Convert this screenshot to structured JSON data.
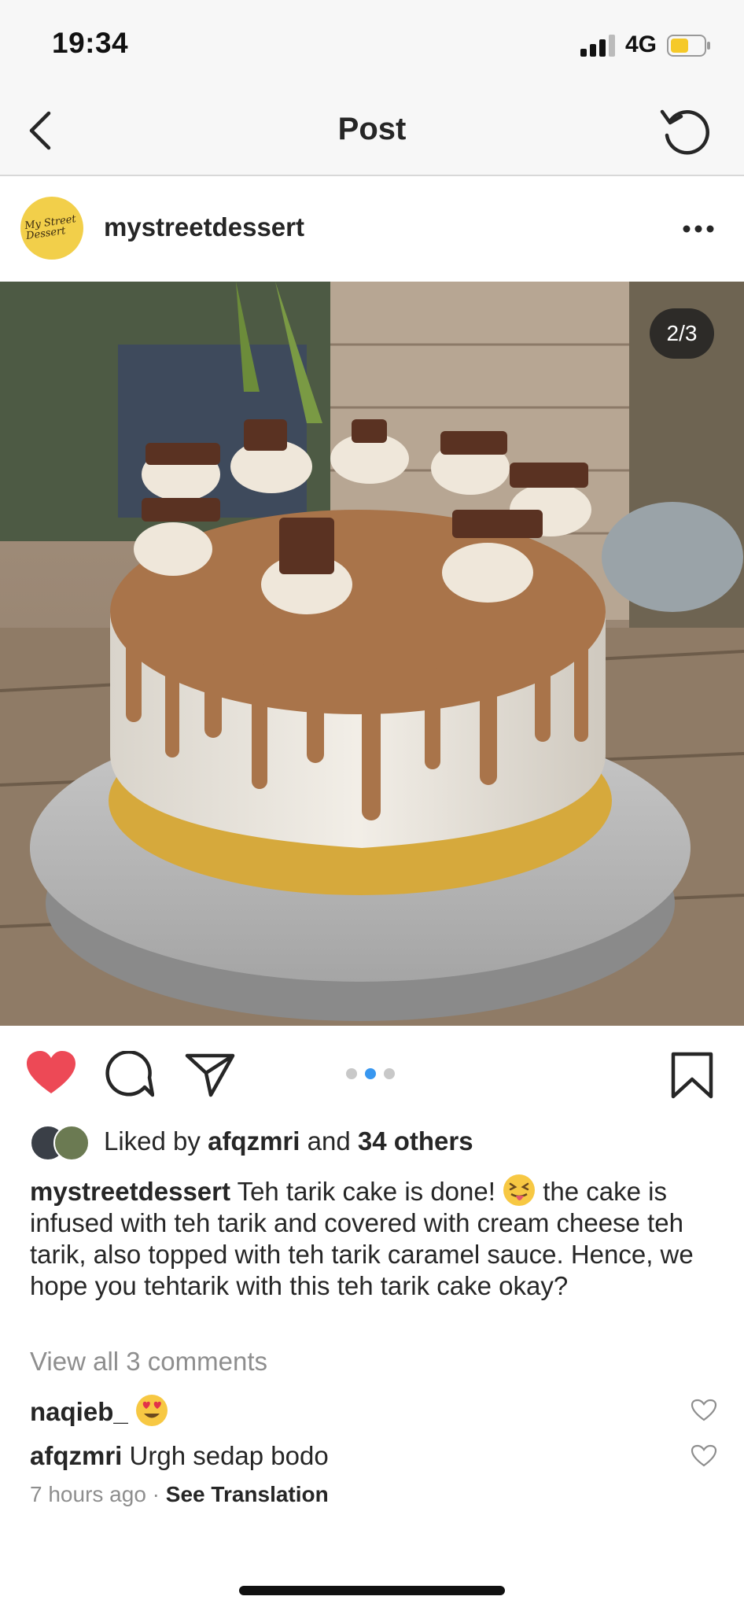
{
  "status_bar": {
    "time": "19:34",
    "network": "4G"
  },
  "nav": {
    "title": "Post"
  },
  "post": {
    "username": "mystreetdessert",
    "avatar_text": "My Street Dessert",
    "image_counter": "2/3",
    "carousel": {
      "count": 3,
      "active_index": 1
    }
  },
  "likes": {
    "prefix": "Liked by",
    "user": "afqzmri",
    "connector": "and",
    "others": "34 others"
  },
  "caption": {
    "username": "mystreetdessert",
    "text_before_emoji": "Teh tarik cake is done!",
    "emoji": "😝",
    "text_after_emoji": "the cake is infused with teh tarik and covered with cream cheese teh tarik, also topped with teh tarik caramel sauce. Hence, we hope you tehtarik with this teh tarik cake okay?"
  },
  "view_all_comments": "View all 3 comments",
  "comments": [
    {
      "username": "naqieb_",
      "text": "",
      "emoji": "😍"
    },
    {
      "username": "afqzmri",
      "text": "Urgh sedap bodo",
      "emoji": ""
    }
  ],
  "meta": {
    "time_ago": "7 hours ago",
    "separator": "·",
    "see_translation": "See Translation"
  },
  "colors": {
    "like_red": "#ed4956",
    "link_blue": "#3897f0",
    "muted_gray": "#8e8e8e",
    "text": "#262626"
  },
  "icons": [
    "back-icon",
    "refresh-icon",
    "more-icon",
    "heart-filled-icon",
    "comment-icon",
    "share-icon",
    "bookmark-icon",
    "small-heart-icon"
  ]
}
